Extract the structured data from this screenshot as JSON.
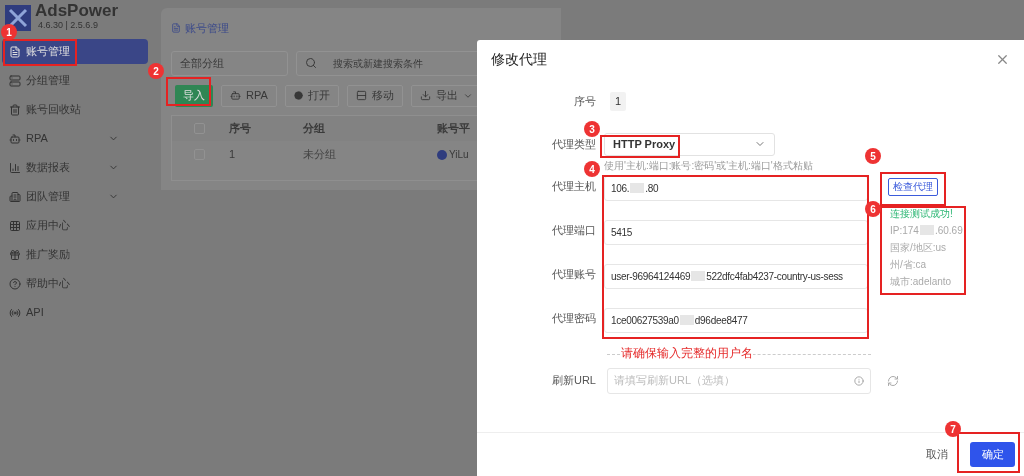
{
  "app": {
    "name": "AdsPower",
    "version": "4.6.30 | 2.5.6.9"
  },
  "sidebar": {
    "items": [
      {
        "label": "账号管理",
        "selected": true,
        "expandable": false
      },
      {
        "label": "分组管理",
        "selected": false,
        "expandable": false
      },
      {
        "label": "账号回收站",
        "selected": false,
        "expandable": false
      },
      {
        "label": "RPA",
        "selected": false,
        "expandable": true
      },
      {
        "label": "数据报表",
        "selected": false,
        "expandable": true
      },
      {
        "label": "团队管理",
        "selected": false,
        "expandable": true
      },
      {
        "label": "应用中心",
        "selected": false,
        "expandable": false
      },
      {
        "label": "推广奖励",
        "selected": false,
        "expandable": false
      },
      {
        "label": "帮助中心",
        "selected": false,
        "expandable": false
      },
      {
        "label": "API",
        "selected": false,
        "expandable": false
      }
    ]
  },
  "main": {
    "tab": "账号管理",
    "group_select": "全部分组",
    "search": {
      "placeholder": "搜索或新建搜索条件"
    },
    "toolbar": [
      {
        "label": "导入",
        "kind": "primary"
      },
      {
        "label": "RPA",
        "kind": "bot"
      },
      {
        "label": "打开",
        "kind": "open"
      },
      {
        "label": "移动",
        "kind": "move"
      },
      {
        "label": "导出",
        "kind": "export"
      }
    ],
    "table": {
      "all_checked": false,
      "columns": [
        "序号",
        "分组",
        "账号平"
      ],
      "rows": [
        {
          "checked": false,
          "cells": [
            "1",
            "未分组",
            "YiLu"
          ]
        }
      ]
    }
  },
  "dialog": {
    "title": "修改代理",
    "index": {
      "label": "序号",
      "value": "1"
    },
    "proxy_type": {
      "label": "代理类型",
      "value": "HTTP Proxy"
    },
    "hint": "使用'主机:端口:账号:密码'或'主机:端口'格式粘贴",
    "fields": [
      {
        "label": "代理主机",
        "parts": [
          "106.",
          ".80"
        ]
      },
      {
        "label": "代理端口",
        "parts": [
          "5415"
        ]
      },
      {
        "label": "代理账号",
        "parts": [
          "user-96964124469",
          "522dfc4fab4237-country-us-sess"
        ]
      },
      {
        "label": "代理密码",
        "parts": [
          "1ce00627539a0",
          "d96dee8477"
        ]
      }
    ],
    "check_button": "检查代理",
    "result": {
      "status": "连接测试成功!",
      "lines": [
        {
          "parts": [
            "IP:174",
            ".60.69"
          ]
        },
        {
          "parts": [
            "国家/地区:us"
          ]
        },
        {
          "parts": [
            "州/省:ca"
          ]
        },
        {
          "parts": [
            "城市:adelanto"
          ]
        }
      ]
    },
    "note": "请确保输入完整的用户名",
    "refresh_url": {
      "label": "刷新URL",
      "placeholder": "请填写刷新URL（选填）"
    },
    "cancel": "取消",
    "confirm": "确定"
  },
  "annotations": [
    {
      "number": "1"
    },
    {
      "number": "2"
    },
    {
      "number": "3"
    },
    {
      "number": "4"
    },
    {
      "number": "5"
    },
    {
      "number": "6"
    },
    {
      "number": "7"
    }
  ]
}
